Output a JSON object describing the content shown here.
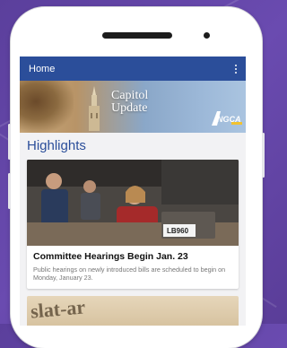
{
  "appbar": {
    "title": "Home",
    "menu_icon": "more-vertical-icon"
  },
  "banner": {
    "line1": "Capitol",
    "line2": "Update",
    "logo_text": "NGCA"
  },
  "section": {
    "title": "Highlights"
  },
  "articles": [
    {
      "image_label": "LB960",
      "title": "Committee Hearings Begin Jan. 23",
      "description": "Public hearings on newly introduced bills are scheduled to begin on Monday, January 23."
    },
    {
      "image_text": "slat-ar"
    }
  ],
  "colors": {
    "appbar": "#2b4e9a",
    "section_title": "#2b4e9a",
    "background": "#5b3f9c"
  }
}
